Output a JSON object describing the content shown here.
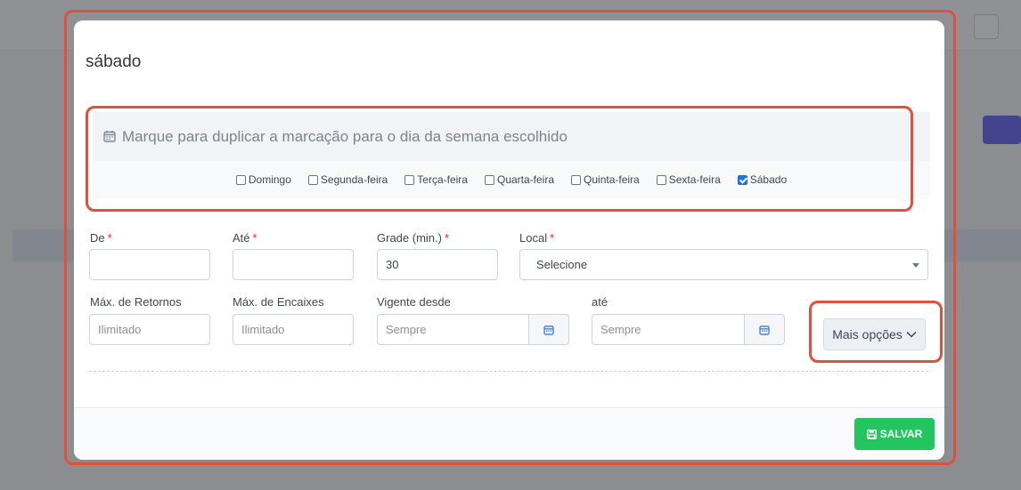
{
  "modal": {
    "title": "sábado",
    "duplicate_hint": "Marque para duplicar a marcação para o dia da semana escolhido",
    "weekdays": [
      {
        "label": "Domingo",
        "checked": false
      },
      {
        "label": "Segunda-feira",
        "checked": false
      },
      {
        "label": "Terça-feira",
        "checked": false
      },
      {
        "label": "Quarta-feira",
        "checked": false
      },
      {
        "label": "Quinta-feira",
        "checked": false
      },
      {
        "label": "Sexta-feira",
        "checked": false
      },
      {
        "label": "Sábado",
        "checked": true
      }
    ],
    "fields": {
      "de": {
        "label": "De",
        "value": ""
      },
      "ate": {
        "label": "Até",
        "value": ""
      },
      "grade": {
        "label": "Grade (min.)",
        "value": "30"
      },
      "local": {
        "label": "Local",
        "value": "Selecione"
      },
      "max_retornos": {
        "label": "Máx. de Retornos",
        "placeholder": "Ilimitado"
      },
      "max_encaixes": {
        "label": "Máx. de Encaixes",
        "placeholder": "Ilimitado"
      },
      "vigente_desde": {
        "label": "Vigente desde",
        "placeholder": "Sempre"
      },
      "vigente_ate": {
        "label": "até",
        "placeholder": "Sempre"
      }
    },
    "required_marker": "*",
    "more_options_label": "Mais opções",
    "save_label": "SALVAR"
  },
  "colors": {
    "annotation": "#e0513d",
    "save_button": "#22c55e",
    "required": "#e02424",
    "checkbox_checked": "#1a73e8"
  }
}
